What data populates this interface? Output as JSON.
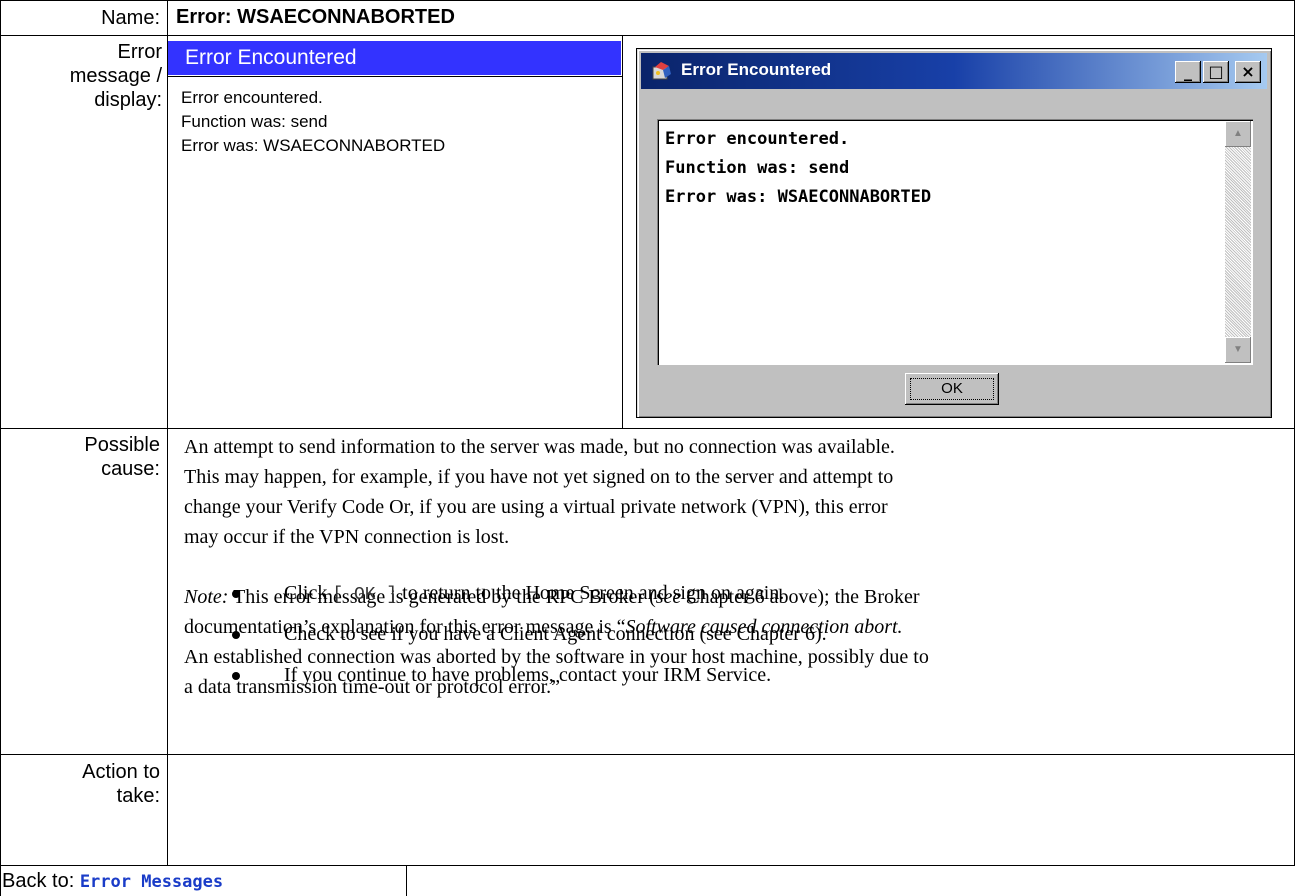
{
  "labels": {
    "name": "Name:",
    "error_msg_line1": "Error",
    "error_msg_line2": "message /",
    "error_msg_line3": "display:",
    "cause_line1": "Possible",
    "cause_line2": "cause:",
    "action_line1": "Action to",
    "action_line2": "take:"
  },
  "name_value": "Error:  WSAECONNABORTED",
  "simple_message": {
    "title": "Error Encountered",
    "lines": [
      "Error encountered.",
      "Function was: send",
      "Error was: WSAECONNABORTED"
    ]
  },
  "dialog": {
    "title": "Error Encountered",
    "icon": "program-icon",
    "lines": [
      "Error encountered.",
      "Function was: send",
      "Error was: WSAECONNABORTED"
    ],
    "ok_label": "OK",
    "minimize": "_",
    "maximize": "□",
    "close": "×",
    "scroll_up": "▲",
    "scroll_down": "▼"
  },
  "cause": {
    "para1_lines": [
      "An attempt to send information to the server was made, but no connection was available.",
      "This may happen, for example, if you have not yet signed on to the server and attempt to",
      "change your Verify Code Or, if you are using a virtual private network (VPN), this error",
      "may occur if the VPN connection is lost."
    ],
    "note_label": "Note:",
    "note_l1a": " This error message is generated by the RPC Broker (",
    "note_l1_see": "see",
    "note_l1b": " Chapter 6 above); the Broker",
    "note_l2a": "documentation’s explanation for this error message is “",
    "note_l2_italic": "Software caused connection abort.",
    "note_l3": "An established connection was aborted by the software in your host machine, possibly due to",
    "note_l4": "a data transmission time-out or protocol error.”"
  },
  "actions": {
    "b1_pre": "Click ",
    "b1_code": "[ OK ]",
    "b1_post": " to return to the Home Screen and sign on again.",
    "b2": "Check to see if you have a Client Agent connection (see Chapter 6).",
    "b3": "If you continue to have problems, contact your IRM Service."
  },
  "back": {
    "label": "Back to: ",
    "link": "Error Messages"
  }
}
